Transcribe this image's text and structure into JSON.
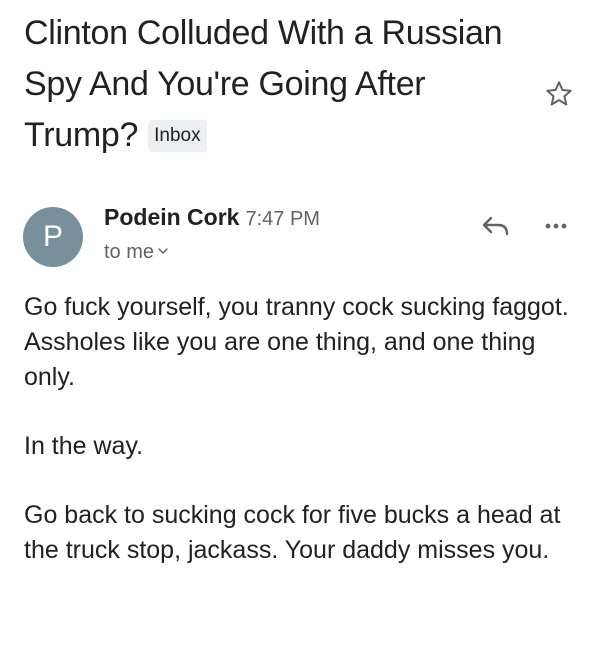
{
  "email": {
    "subject": "Clinton Colluded With a Russian Spy And You're Going After Trump?",
    "label_badge": "Inbox",
    "sender": {
      "initial": "P",
      "name": "Podein Cork",
      "time": "7:47 PM",
      "recipient": "to me"
    },
    "body": [
      "Go fuck yourself, you tranny cock sucking faggot. Assholes like you are one thing, and one thing only.",
      "In the way.",
      "Go back to sucking cock for five bucks a head at the truck stop, jackass. Your daddy misses you."
    ]
  },
  "icons": {
    "star": "star-outline-icon",
    "reply": "reply-icon",
    "more": "more-horizontal-icon",
    "recipient_expand": "chevron-down-icon"
  },
  "colors": {
    "avatar": "#78909c",
    "badge_bg": "#eceff1",
    "text_primary": "#202124",
    "text_secondary": "#5f6368",
    "icon": "#5f6368"
  }
}
